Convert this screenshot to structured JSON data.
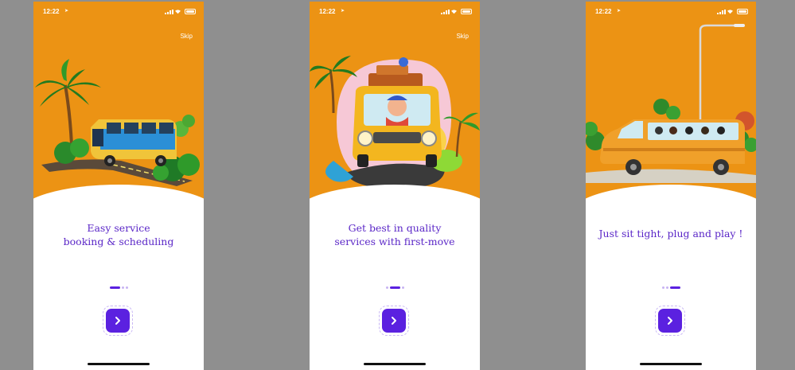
{
  "screens": [
    {
      "time": "12:22",
      "skip_label": "Skip",
      "caption_line1": "Easy service",
      "caption_line2": "booking & scheduling",
      "page_index": 0,
      "icons": [
        "palm-tree",
        "bus",
        "bushes",
        "road"
      ]
    },
    {
      "time": "12:22",
      "skip_label": "Skip",
      "caption_line1": "Get best in quality",
      "caption_line2": "services with first-move",
      "page_index": 1,
      "icons": [
        "palm-tree",
        "van",
        "driver",
        "luggage",
        "road"
      ]
    },
    {
      "time": "12:22",
      "skip_label": "",
      "caption_line1": "Just sit tight, plug and play !",
      "caption_line2": "",
      "page_index": 2,
      "icons": [
        "street-lamp",
        "bus",
        "passengers",
        "trees"
      ]
    }
  ],
  "pager": {
    "count": 3
  },
  "next_icon": "chevron-right-icon",
  "colors": {
    "orange": "#ec9314",
    "purple": "#5b21e0",
    "caption": "#5a26c7",
    "background": "#8f8f8f"
  }
}
